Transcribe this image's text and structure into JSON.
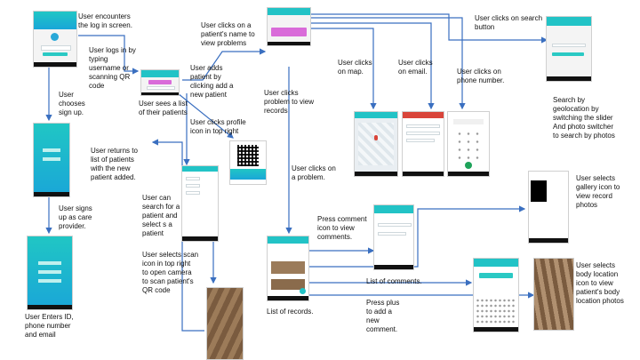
{
  "labels": {
    "encounter_login": "User encounters\nthe log in screen.",
    "logs_in": "User logs in by\ntyping\nusername or\nscanning QR\ncode",
    "chooses_signup": "User\nchooses\nsign up.",
    "sees_patients": "User sees a list\nof their patients",
    "adds_patient": "User adds\npatient by\nclicking add a\nnew patient",
    "clicks_patient_name": "User clicks on a\npatient's name to\nview problems",
    "clicks_search": "User clicks on search\nbutton",
    "clicks_map": "User clicks\non map.",
    "clicks_email": "User clicks\non email.",
    "clicks_phone": "User clicks on\nphone number.",
    "clicks_problem_records": "User clicks\nproblem to view\nrecords",
    "clicks_profile": "User clicks profile\nicon in top right",
    "returns_list": "User returns to\nlist of patients\nwith the new\npatient added.",
    "signs_up": "User signs\nup as care\nprovider.",
    "search_select": "User can\nsearch for a\npatient and\nselect s a\npatient",
    "scan_icon": "User selects scan\nicon in top right\nto open camera\nto scan patient's\nQR code",
    "clicks_a_problem": "User clicks on\na problem.",
    "search_geo": "Search by\ngeolocation by\nswitching the slider\nAnd photo switcher\nto search by photos",
    "gallery_icon": "User selects\ngallery icon to\nview record\nphotos",
    "press_comment": "Press comment\nicon to view\ncomments.",
    "list_comments": "List of comments.",
    "body_location": "User selects\nbody location\nicon to view\npatient's body\nlocation photos",
    "list_records": "List of records.",
    "press_plus": "Press plus\nto add a\nnew\ncomment.",
    "enters_id": "User Enters ID,\nphone number\nand email"
  },
  "colors": {
    "accent": "#22c3c6",
    "arrow": "#3a6fc0",
    "pink": "#d96bd9",
    "gmail_red": "#d9453a"
  }
}
